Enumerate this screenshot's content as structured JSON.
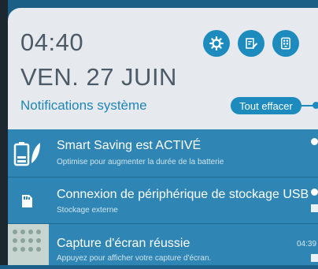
{
  "header": {
    "time": "04:40",
    "date": "VEN. 27 JUIN",
    "title": "Notifications système",
    "clear_label": "Tout effacer",
    "quick_buttons": [
      {
        "name": "settings-icon"
      },
      {
        "name": "edit-note-icon"
      },
      {
        "name": "apps-grid-icon"
      }
    ]
  },
  "notifications": [
    {
      "title": "Smart Saving est ACTIVÉ",
      "subtitle": "Optimise pour augmenter la durée de la batterie",
      "icon": "battery-leaf-icon"
    },
    {
      "title": "Connexion de périphérique de stockage USB",
      "subtitle": "Stockage externe",
      "icon": "sd-card-icon"
    },
    {
      "title": "Capture d'écran réussie",
      "subtitle": "Appuyez pour afficher votre capture d'écran.",
      "time": "04:39",
      "icon": "screenshot-thumbnail"
    }
  ],
  "colors": {
    "accent": "#1d8bbd",
    "header_bg": "#e6eaee",
    "notification_bg": "#2f86b4"
  }
}
